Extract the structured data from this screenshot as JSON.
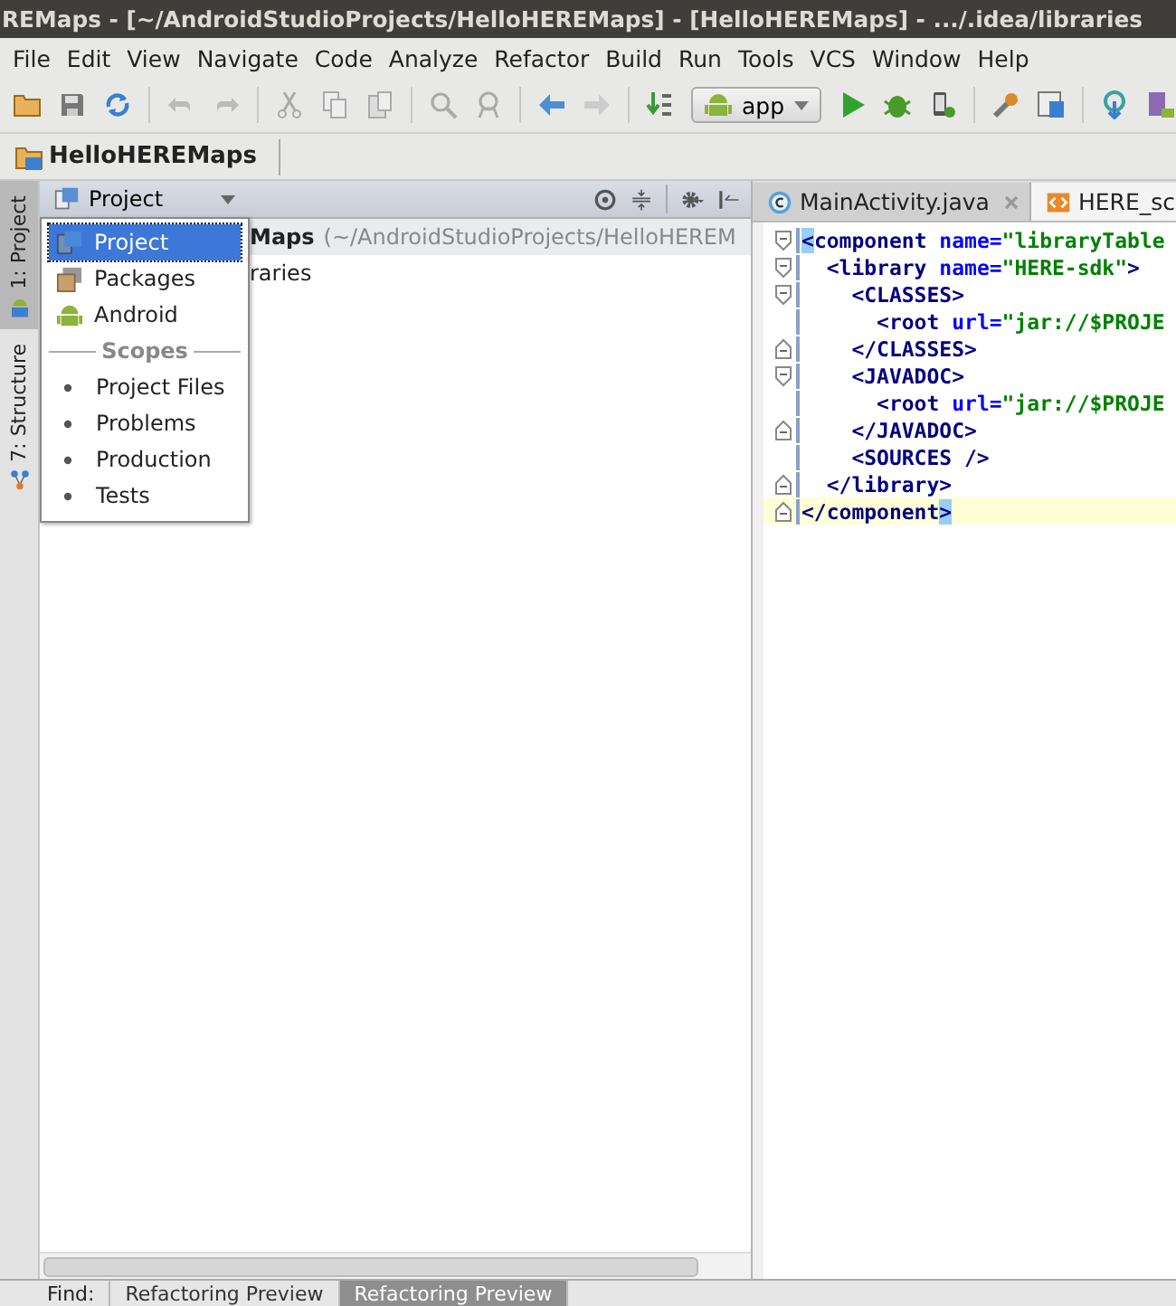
{
  "window": {
    "title": "REMaps - [~/AndroidStudioProjects/HelloHEREMaps] - [HelloHEREMaps] - .../.idea/libraries"
  },
  "menu": [
    "File",
    "Edit",
    "View",
    "Navigate",
    "Code",
    "Analyze",
    "Refactor",
    "Build",
    "Run",
    "Tools",
    "VCS",
    "Window",
    "Help"
  ],
  "toolbar": {
    "run_config": "app"
  },
  "breadcrumb": [
    "HelloHEREMaps"
  ],
  "side_tabs": [
    {
      "label": "1: Project",
      "selected": true
    },
    {
      "label": "7: Structure",
      "selected": false
    }
  ],
  "project_panel": {
    "view": "Project",
    "tree": [
      {
        "name": "Maps",
        "path": "(~/AndroidStudioProjects/HelloHEREM"
      },
      {
        "name": "raries"
      }
    ]
  },
  "view_menu": [
    {
      "kind": "view",
      "label": "Project",
      "selected": true
    },
    {
      "kind": "view",
      "label": "Packages",
      "selected": false
    },
    {
      "kind": "view",
      "label": "Android",
      "selected": false
    },
    {
      "kind": "header",
      "label": "Scopes"
    },
    {
      "kind": "scope",
      "label": "Project Files",
      "selected": false
    },
    {
      "kind": "scope",
      "label": "Problems",
      "selected": false
    },
    {
      "kind": "scope",
      "label": "Production",
      "selected": false
    },
    {
      "kind": "scope",
      "label": "Tests",
      "selected": false
    }
  ],
  "editor_tabs": [
    {
      "label": "MainActivity.java",
      "kind": "java",
      "selected": false
    },
    {
      "label": "HERE_sc",
      "kind": "xml",
      "selected": true
    }
  ],
  "code": [
    {
      "fold_open": true,
      "fold_close": false,
      "current": false,
      "segments": [
        {
          "text": "<",
          "kind": "tag",
          "match": true
        },
        {
          "text": "component",
          "kind": "tag",
          "match": false
        },
        {
          "text": " name=",
          "kind": "attr",
          "match": false
        },
        {
          "text": "\"libraryTable",
          "kind": "value",
          "match": false
        }
      ]
    },
    {
      "fold_open": true,
      "fold_close": false,
      "current": false,
      "segments": [
        {
          "text": "  <library",
          "kind": "tag",
          "match": false
        },
        {
          "text": " name=",
          "kind": "attr",
          "match": false
        },
        {
          "text": "\"HERE-sdk\"",
          "kind": "value",
          "match": false
        },
        {
          "text": ">",
          "kind": "tag",
          "match": false
        }
      ]
    },
    {
      "fold_open": true,
      "fold_close": false,
      "current": false,
      "segments": [
        {
          "text": "    <CLASSES>",
          "kind": "tag",
          "match": false
        }
      ]
    },
    {
      "fold_open": false,
      "fold_close": false,
      "current": false,
      "segments": [
        {
          "text": "      <root",
          "kind": "tag",
          "match": false
        },
        {
          "text": " url=",
          "kind": "attr",
          "match": false
        },
        {
          "text": "\"jar://$PROJE",
          "kind": "value",
          "match": false
        }
      ]
    },
    {
      "fold_open": false,
      "fold_close": true,
      "current": false,
      "segments": [
        {
          "text": "    </CLASSES>",
          "kind": "tag",
          "match": false
        }
      ]
    },
    {
      "fold_open": true,
      "fold_close": false,
      "current": false,
      "segments": [
        {
          "text": "    <JAVADOC>",
          "kind": "tag",
          "match": false
        }
      ]
    },
    {
      "fold_open": false,
      "fold_close": false,
      "current": false,
      "segments": [
        {
          "text": "      <root",
          "kind": "tag",
          "match": false
        },
        {
          "text": " url=",
          "kind": "attr",
          "match": false
        },
        {
          "text": "\"jar://$PROJE",
          "kind": "value",
          "match": false
        }
      ]
    },
    {
      "fold_open": false,
      "fold_close": true,
      "current": false,
      "segments": [
        {
          "text": "    </JAVADOC>",
          "kind": "tag",
          "match": false
        }
      ]
    },
    {
      "fold_open": false,
      "fold_close": false,
      "current": false,
      "segments": [
        {
          "text": "    <SOURCES />",
          "kind": "tag",
          "match": false
        }
      ]
    },
    {
      "fold_open": false,
      "fold_close": true,
      "current": false,
      "segments": [
        {
          "text": "  </library>",
          "kind": "tag",
          "match": false
        }
      ]
    },
    {
      "fold_open": false,
      "fold_close": true,
      "current": true,
      "segments": [
        {
          "text": "</component",
          "kind": "tag",
          "match": false
        },
        {
          "text": ">",
          "kind": "tag",
          "match": true
        }
      ]
    }
  ],
  "bottom_tabs": [
    {
      "label": "Find:",
      "kind": "label"
    },
    {
      "label": "Refactoring Preview",
      "kind": "tab",
      "selected": false
    },
    {
      "label": "Refactoring Preview",
      "kind": "tab",
      "selected": true
    }
  ]
}
